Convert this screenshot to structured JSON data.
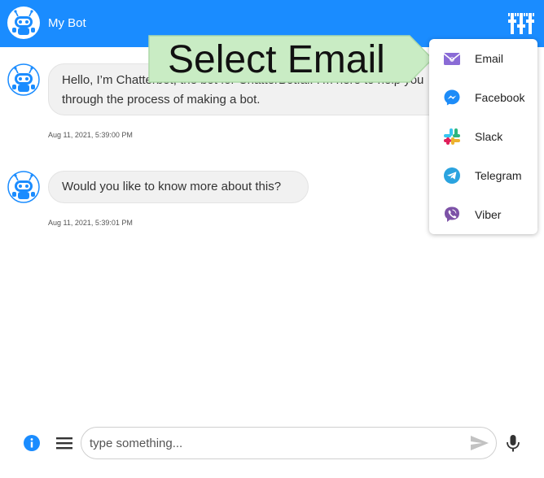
{
  "header": {
    "title": "My Bot",
    "background_color": "#1a8cff",
    "avatar_icon": "bot-avatar-icon",
    "channels_icon": "channels-settings-icon"
  },
  "messages": [
    {
      "text": "Hello, I’m Chatterbot, the bot for ChatterBot.ai. I’m here to help you through the process of making a bot.",
      "timestamp": "Aug 11, 2021, 5:39:00 PM"
    },
    {
      "text": "Would you like to know more about this?",
      "timestamp": "Aug 11, 2021, 5:39:01 PM"
    }
  ],
  "callout": {
    "text": "Select Email",
    "color": "#c9ecc4"
  },
  "channels_menu": [
    {
      "label": "Email",
      "icon": "email-icon"
    },
    {
      "label": "Facebook",
      "icon": "facebook-messenger-icon"
    },
    {
      "label": "Slack",
      "icon": "slack-icon"
    },
    {
      "label": "Telegram",
      "icon": "telegram-icon"
    },
    {
      "label": "Viber",
      "icon": "viber-icon"
    }
  ],
  "composer": {
    "placeholder": "type something...",
    "value": "",
    "info_icon": "info-icon",
    "menu_icon": "menu-icon",
    "send_icon": "send-icon",
    "mic_icon": "microphone-icon",
    "accent_color": "#1a8cff"
  }
}
